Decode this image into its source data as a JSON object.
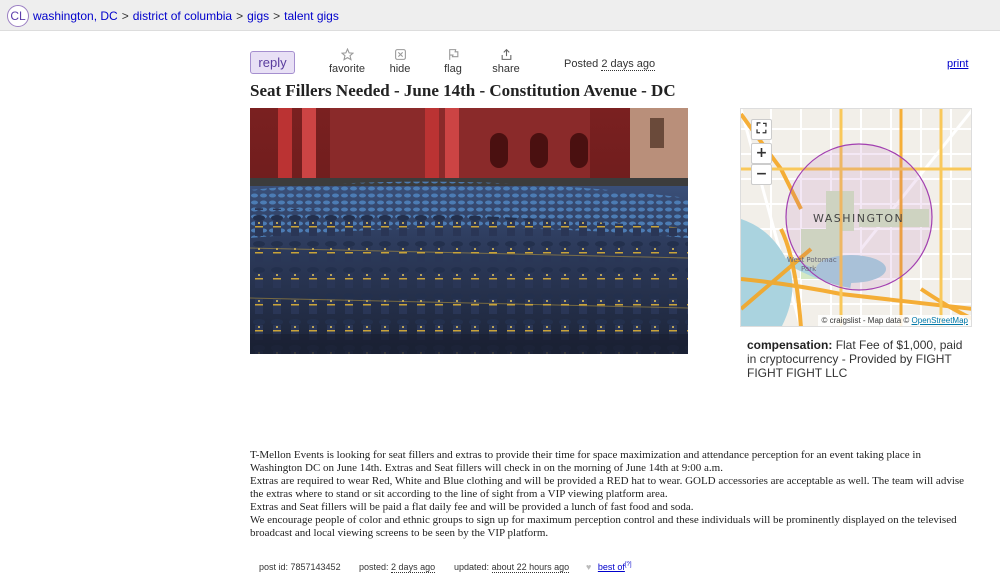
{
  "header": {
    "logo": "CL",
    "breadcrumbs": [
      "washington, DC",
      "district of columbia",
      "gigs",
      "talent gigs"
    ],
    "separator": ">"
  },
  "actions": {
    "reply_label": "reply",
    "favorite_label": "favorite",
    "hide_label": "hide",
    "flag_label": "flag",
    "share_label": "share",
    "posted_prefix": "Posted",
    "posted_time": "2 days ago",
    "print_label": "print"
  },
  "post": {
    "title": "Seat Fillers Needed - June 14th - Constitution Avenue - DC",
    "body": [
      "T-Mellon Events is looking for seat fillers and extras to provide their time for space maximization and attendance perception for an event taking place in Washington DC on June 14th. Extras and Seat fillers will check in on the morning of June 14th at 9:00 a.m.",
      "Extras are required to wear Red, White and Blue clothing and will be provided a RED hat to wear. GOLD accessories are acceptable as well. The team will advise the extras where to stand or sit according to the line of sight from a VIP viewing platform area.",
      "Extras and Seat fillers will be paid a flat daily fee and will be provided a lunch of fast food and soda.",
      "We encourage people of color and ethnic groups to sign up for maximum perception control and these individuals will be prominently displayed on the televised broadcast and local viewing screens to be seen by the VIP platform."
    ]
  },
  "map": {
    "city_label": "WASHINGTON",
    "park_label_1": "West Potomac",
    "park_label_2": "Park",
    "attribution_prefix": "© craigslist - Map data ©",
    "attribution_link": "OpenStreetMap",
    "fullscreen_glyph": "⛶",
    "zoom_in_glyph": "+",
    "zoom_out_glyph": "−"
  },
  "attributes": {
    "compensation_label": "compensation:",
    "compensation_value": "Flat Fee of $1,000, paid in cryptocurrency - Provided by FIGHT FIGHT FIGHT LLC"
  },
  "footer": {
    "post_id_label": "post id: 7857143452",
    "posted_label": "posted:",
    "posted_value": "2 days ago",
    "updated_label": "updated:",
    "updated_value": "about 22 hours ago",
    "best_of_label": "best of",
    "best_of_sup": "[?]"
  },
  "icons": [
    "star-icon",
    "hide-icon",
    "flag-icon",
    "share-icon",
    "heart-icon",
    "fullscreen-icon"
  ],
  "colors": {
    "link": "#0000cc",
    "reply_bg": "#e8e0f5",
    "reply_border": "#a58fcf",
    "map_radius": "#a23fb0"
  }
}
